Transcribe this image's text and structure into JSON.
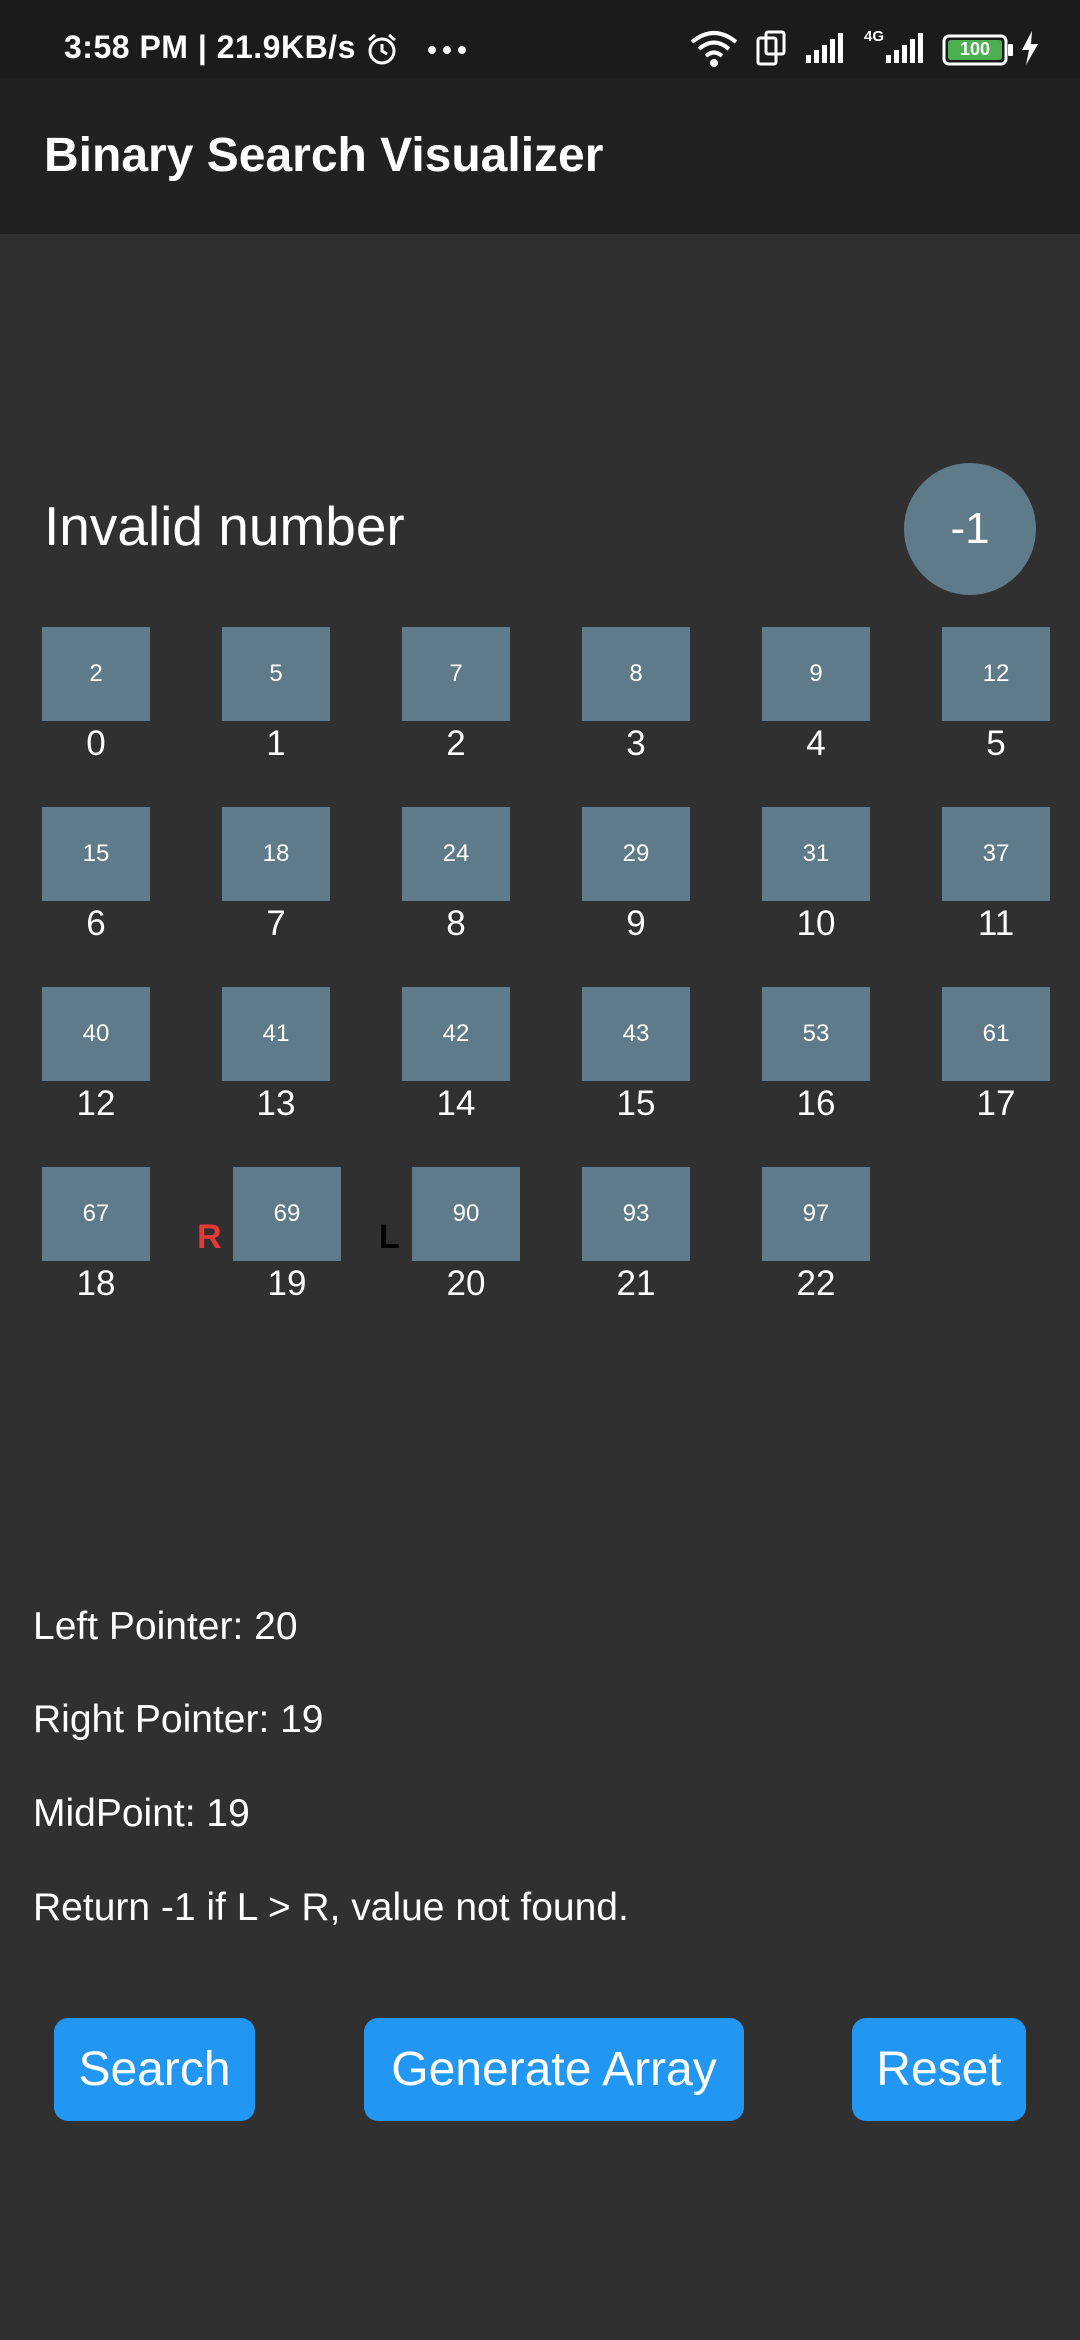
{
  "status_bar": {
    "time": "3:58 PM",
    "net_speed": "21.9KB/s",
    "network_label": "4G",
    "battery": "100"
  },
  "app_bar": {
    "title": "Binary Search Visualizer"
  },
  "message": "Invalid number",
  "target_value": "-1",
  "array": {
    "values": [
      "2",
      "5",
      "7",
      "8",
      "9",
      "12",
      "15",
      "18",
      "24",
      "29",
      "31",
      "37",
      "40",
      "41",
      "42",
      "43",
      "53",
      "61",
      "67",
      "69",
      "90",
      "93",
      "97"
    ],
    "indices": [
      "0",
      "1",
      "2",
      "3",
      "4",
      "5",
      "6",
      "7",
      "8",
      "9",
      "10",
      "11",
      "12",
      "13",
      "14",
      "15",
      "16",
      "17",
      "18",
      "19",
      "20",
      "21",
      "22"
    ]
  },
  "pointers": {
    "right_label": "R",
    "left_label": "L",
    "right_color": "#e53935",
    "left_color": "#000000"
  },
  "info": {
    "left_pointer": "Left Pointer: 20",
    "right_pointer": "Right Pointer: 19",
    "midpoint": "MidPoint: 19",
    "note": "Return -1 if L > R, value not found."
  },
  "buttons": {
    "search": "Search",
    "generate": "Generate Array",
    "reset": "Reset"
  },
  "colors": {
    "cell": "#5f7b89",
    "button": "#2196f3",
    "background": "#303030"
  }
}
